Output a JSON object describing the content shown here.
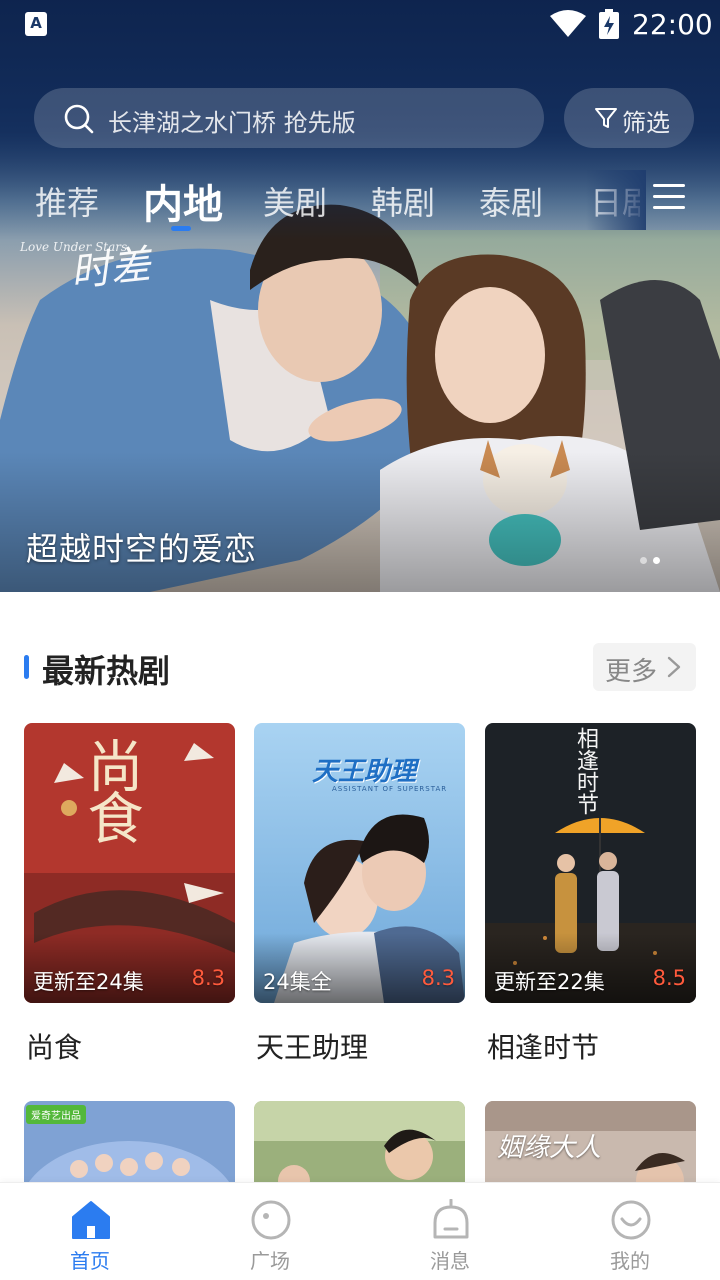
{
  "status_bar": {
    "time": "22:00",
    "app_icon_letter": "A"
  },
  "search": {
    "placeholder": "长津湖之水门桥 抢先版",
    "filter_label": "筛选"
  },
  "tabs": [
    {
      "label": "推荐"
    },
    {
      "label": "内地"
    },
    {
      "label": "美剧"
    },
    {
      "label": "韩剧"
    },
    {
      "label": "泰剧"
    },
    {
      "label": "日剧"
    }
  ],
  "active_tab": "内地",
  "hero": {
    "caption": "超越时空的爱恋",
    "poster_title": "时差",
    "poster_subtitle": "Love Under Stars",
    "slide_count": 2,
    "active_slide": 2
  },
  "section": {
    "title": "最新热剧",
    "more_label": "更多"
  },
  "dramas": [
    {
      "title": "尚食",
      "episodes": "更新至24集",
      "score": "8.3",
      "poster_text": "尚食"
    },
    {
      "title": "天王助理",
      "episodes": "24集全",
      "score": "8.3",
      "poster_text": "天王助理",
      "poster_sub": "ASSISTANT OF SUPERSTAR"
    },
    {
      "title": "相逢时节",
      "episodes": "更新至22集",
      "score": "8.5",
      "poster_text": "相逢时节"
    }
  ],
  "dramas_row2": [
    {
      "badge": "爱奇艺出品"
    },
    {
      "badge": ""
    },
    {
      "poster_text": "姻缘大人"
    }
  ],
  "bottom_nav": [
    {
      "label": "首页",
      "icon": "home-icon",
      "active": true
    },
    {
      "label": "广场",
      "icon": "planet-icon",
      "active": false
    },
    {
      "label": "消息",
      "icon": "bell-icon",
      "active": false
    },
    {
      "label": "我的",
      "icon": "smile-icon",
      "active": false
    }
  ],
  "colors": {
    "accent": "#2b7cf0",
    "score": "#ff5a3c",
    "header_bg": "#152f5c"
  }
}
